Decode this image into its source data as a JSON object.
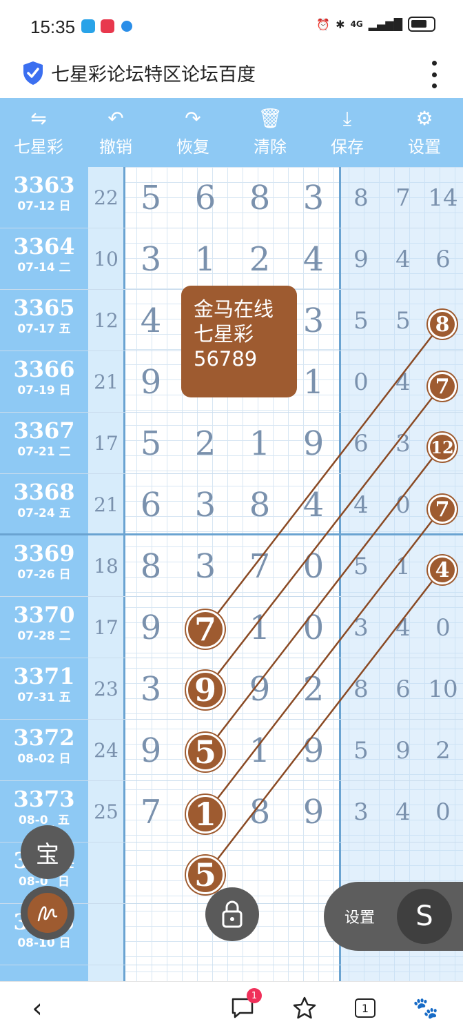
{
  "status_bar": {
    "time": "15:35",
    "network": "4G"
  },
  "browser": {
    "title": "七星彩论坛特区论坛百度"
  },
  "toolbar": {
    "items": [
      {
        "label": "七星彩",
        "icon": "swap-icon"
      },
      {
        "label": "撤销",
        "icon": "undo-icon"
      },
      {
        "label": "恢复",
        "icon": "redo-icon"
      },
      {
        "label": "清除",
        "icon": "trash-icon"
      },
      {
        "label": "保存",
        "icon": "download-icon"
      },
      {
        "label": "设置",
        "icon": "gear-icon"
      }
    ]
  },
  "rows": [
    {
      "issue": "3363",
      "date": "07-12 日",
      "sum": "22",
      "main": [
        "5",
        "6",
        "8",
        "3"
      ],
      "extra": [
        "8",
        "7",
        "14"
      ]
    },
    {
      "issue": "3364",
      "date": "07-14 二",
      "sum": "10",
      "main": [
        "3",
        "1",
        "2",
        "4"
      ],
      "extra": [
        "9",
        "4",
        "6"
      ]
    },
    {
      "issue": "3365",
      "date": "07-17 五",
      "sum": "12",
      "main": [
        "4",
        "",
        "",
        "3"
      ],
      "extra": [
        "5",
        "5",
        ""
      ]
    },
    {
      "issue": "3366",
      "date": "07-19 日",
      "sum": "21",
      "main": [
        "9",
        "",
        "",
        "1"
      ],
      "extra": [
        "0",
        "4",
        ""
      ]
    },
    {
      "issue": "3367",
      "date": "07-21 二",
      "sum": "17",
      "main": [
        "5",
        "2",
        "1",
        "9"
      ],
      "extra": [
        "6",
        "3",
        ""
      ]
    },
    {
      "issue": "3368",
      "date": "07-24 五",
      "sum": "21",
      "main": [
        "6",
        "3",
        "8",
        "4"
      ],
      "extra": [
        "4",
        "0",
        ""
      ]
    },
    {
      "issue": "3369",
      "date": "07-26 日",
      "sum": "18",
      "main": [
        "8",
        "3",
        "7",
        "0"
      ],
      "extra": [
        "5",
        "1",
        ""
      ]
    },
    {
      "issue": "3370",
      "date": "07-28 二",
      "sum": "17",
      "main": [
        "9",
        "",
        "1",
        "0"
      ],
      "extra": [
        "3",
        "4",
        "0"
      ]
    },
    {
      "issue": "3371",
      "date": "07-31 五",
      "sum": "23",
      "main": [
        "3",
        "",
        "9",
        "2"
      ],
      "extra": [
        "8",
        "6",
        "10"
      ]
    },
    {
      "issue": "3372",
      "date": "08-02 日",
      "sum": "24",
      "main": [
        "9",
        "",
        "1",
        "9"
      ],
      "extra": [
        "5",
        "9",
        "2"
      ]
    },
    {
      "issue": "3373",
      "date": "08-0_ 五",
      "sum": "25",
      "main": [
        "7",
        "",
        "8",
        "9"
      ],
      "extra": [
        "3",
        "4",
        "0"
      ]
    },
    {
      "issue": "3374",
      "date": "08-0_ 日",
      "sum": "",
      "main": [
        "",
        "",
        "",
        ""
      ],
      "extra": [
        "",
        "",
        ""
      ]
    },
    {
      "issue": "3375",
      "date": "08-10 日",
      "sum": "",
      "main": [
        "",
        "",
        "",
        ""
      ],
      "extra": [
        "",
        "",
        ""
      ]
    }
  ],
  "popup": {
    "line1": "金马在线",
    "line2": "七星彩",
    "line3": "56789"
  },
  "balls": {
    "column": [
      "7",
      "9",
      "5",
      "1",
      "5"
    ],
    "right": [
      "8",
      "7",
      "12",
      "7",
      "4"
    ]
  },
  "floating": {
    "bao": "宝",
    "settings_label": "设置",
    "s_label": "S"
  },
  "bottom_nav": {
    "tabs_count": "1",
    "notif_count": "1"
  },
  "colors": {
    "toolbar": "#8ec9f4",
    "ball": "#9e5b30",
    "grid_text": "#7a91ad"
  }
}
